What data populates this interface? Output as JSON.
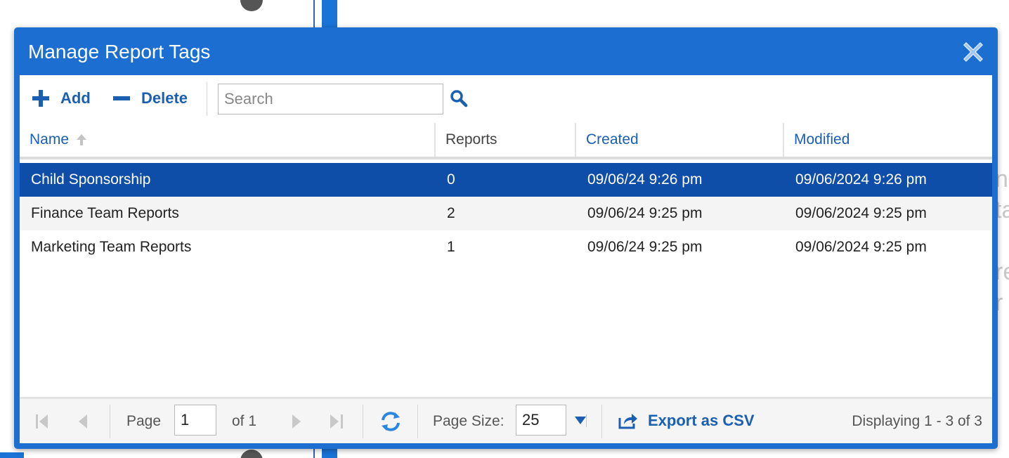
{
  "background": {
    "right_text_fragments": [
      "ne",
      "ta",
      "re",
      "r"
    ]
  },
  "dialog": {
    "title": "Manage Report Tags",
    "close_icon": "close-icon"
  },
  "toolbar": {
    "add_label": "Add",
    "delete_label": "Delete",
    "search_placeholder": "Search",
    "search_value": ""
  },
  "grid": {
    "columns": [
      {
        "label": "Name",
        "sorted": "ascending"
      },
      {
        "label": "Reports"
      },
      {
        "label": "Created"
      },
      {
        "label": "Modified"
      }
    ],
    "rows": [
      {
        "name": "Child Sponsorship",
        "reports": "0",
        "created": "09/06/24 9:26 pm",
        "modified": "09/06/2024 9:26 pm",
        "selected": true
      },
      {
        "name": "Finance Team Reports",
        "reports": "2",
        "created": "09/06/24 9:25 pm",
        "modified": "09/06/2024 9:25 pm",
        "selected": false
      },
      {
        "name": "Marketing Team Reports",
        "reports": "1",
        "created": "09/06/24 9:25 pm",
        "modified": "09/06/2024 9:25 pm",
        "selected": false
      }
    ]
  },
  "paging": {
    "page_label": "Page",
    "page_value": "1",
    "of_label": "of 1",
    "page_size_label": "Page Size:",
    "page_size_value": "25",
    "export_label": "Export as CSV",
    "display_info": "Displaying 1 - 3 of 3"
  },
  "colors": {
    "dialog_blue": "#1c6fd1",
    "selected_row": "#0f4ea8",
    "link_blue": "#1b5fb3"
  }
}
